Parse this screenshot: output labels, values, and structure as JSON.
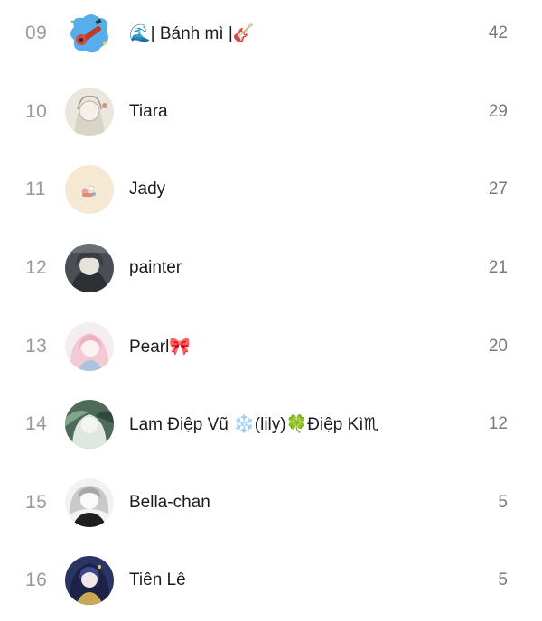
{
  "leaderboard": {
    "rows": [
      {
        "rank": "09",
        "name": "🌊| Bánh mì |🎸",
        "score": "42",
        "avatar_icon": "guitar-sticker-icon",
        "avatar_color": "#4aa3e8"
      },
      {
        "rank": "10",
        "name": "Tiara",
        "score": "29",
        "avatar_icon": "sketch-girl-avatar",
        "avatar_color": "#ece7dc"
      },
      {
        "rank": "11",
        "name": "Jady",
        "score": "27",
        "avatar_icon": "cute-items-avatar",
        "avatar_color": "#f6e9d4"
      },
      {
        "rank": "12",
        "name": "painter",
        "score": "21",
        "avatar_icon": "dark-anime-boy-avatar",
        "avatar_color": "#4a4f55"
      },
      {
        "rank": "13",
        "name": "Pearl🎀",
        "score": "20",
        "avatar_icon": "pink-hair-girl-avatar",
        "avatar_color": "#f3c9d4"
      },
      {
        "rank": "14",
        "name": "Lam Điệp Vũ ❄️(lily)🍀Điệp Kì♏",
        "score": "12",
        "avatar_icon": "green-anime-avatar",
        "avatar_color": "#4d6a5a"
      },
      {
        "rank": "15",
        "name": "Bella-chan",
        "score": "5",
        "avatar_icon": "grey-hair-girl-avatar",
        "avatar_color": "#c9c9c9"
      },
      {
        "rank": "16",
        "name": "Tiên Lê",
        "score": "5",
        "avatar_icon": "dark-blue-anime-avatar",
        "avatar_color": "#2b3563"
      }
    ]
  }
}
